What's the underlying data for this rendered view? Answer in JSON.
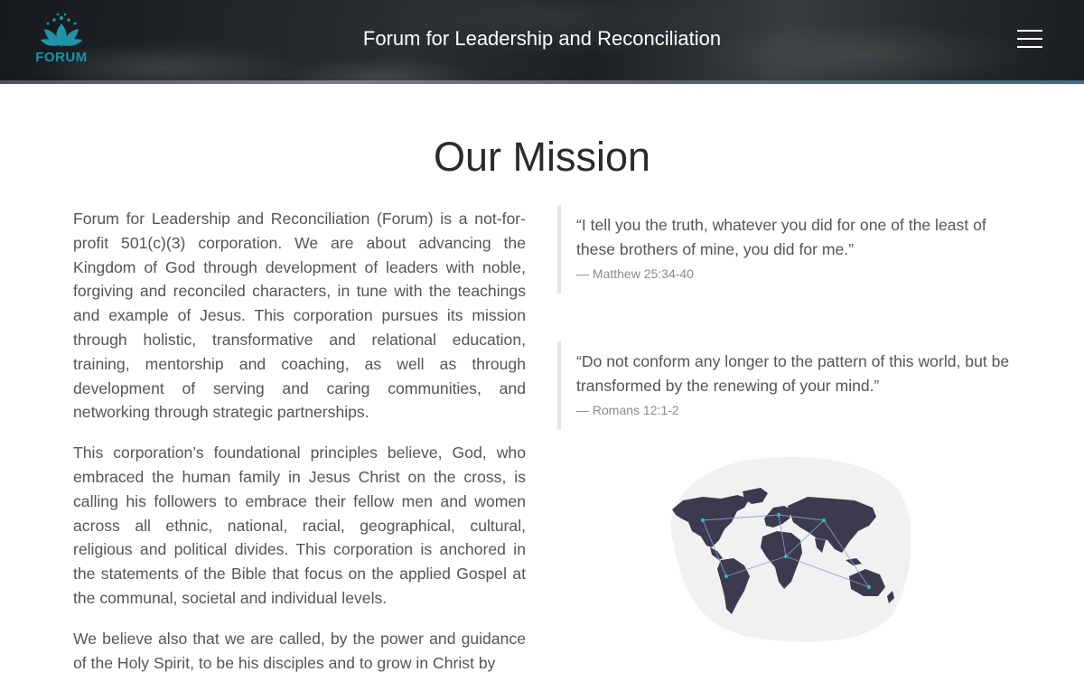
{
  "header": {
    "logo_text": "FORUM",
    "title": "Forum for Leadership and Reconciliation",
    "menu_icon": "hamburger-menu-icon"
  },
  "main": {
    "title": "Our Mission",
    "paragraphs": [
      "Forum for Leadership and Reconciliation (Forum) is a not-for-profit 501(c)(3) corporation. We are about advancing the Kingdom of God through development of leaders with noble, forgiving and reconciled characters, in tune with the teachings and example of Jesus. This corporation pursues its mission through holistic, transformative and relational education, training, mentorship and coaching, as well as through development of serving and caring communities, and networking through strategic partnerships.",
      "This corporation’s foundational principles believe, God, who embraced the human family in Jesus Christ on the cross, is calling his followers to embrace their fellow men and women across all ethnic, national, racial, geographical, cultural, religious and political divides. This corporation is anchored in the statements of the Bible that focus on the applied Gospel at the communal, societal and individual levels.",
      "We believe also that we are called, by the power and guidance of the Holy Spirit, to be his disciples and to grow in Christ by"
    ],
    "quotes": [
      {
        "text": "“I tell you the truth, whatever you did for one of the least of these brothers of mine, you did for me.”",
        "cite": "— Matthew 25:34-40"
      },
      {
        "text": "“Do not conform any longer to the pattern of this world, but be transformed by the renewing of your mind.”",
        "cite": "— Romans 12:1-2"
      }
    ],
    "illustration": "world-map-network-icon"
  },
  "colors": {
    "brand": "#1f93a8",
    "map": "#3b3a4f",
    "map_bg": "#f1f1f1",
    "text": "#555555",
    "quote_border": "#e5e5e5"
  }
}
